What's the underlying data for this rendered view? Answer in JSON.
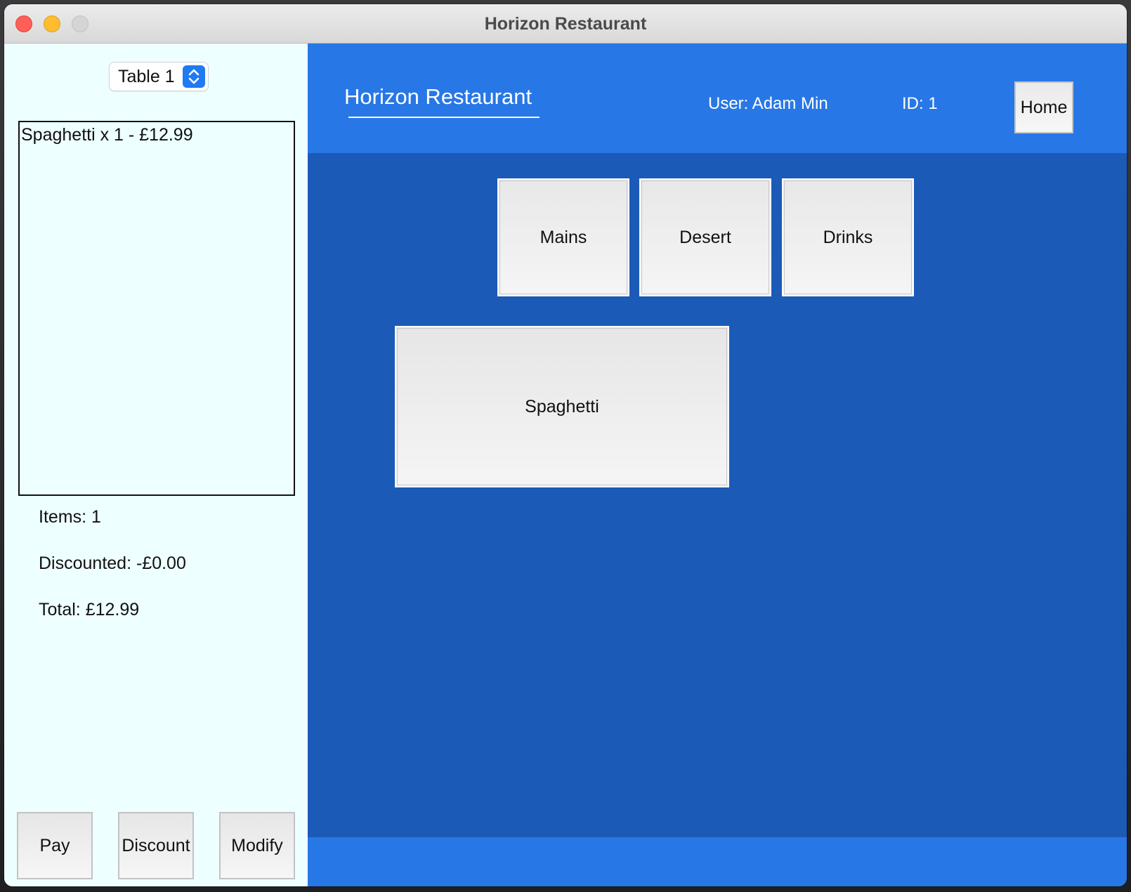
{
  "window": {
    "title": "Horizon Restaurant"
  },
  "left_panel": {
    "table_select": {
      "selected": "Table 1"
    },
    "order_items": [
      "Spaghetti x 1 - £12.99"
    ],
    "summary": {
      "items": "Items: 1",
      "discounted": "Discounted: -£0.00",
      "total": "Total: £12.99"
    },
    "buttons": {
      "pay": "Pay",
      "discount": "Discount",
      "modify": "Modify"
    }
  },
  "header": {
    "brand": "Horizon Restaurant",
    "user": "User: Adam Min",
    "id": "ID: 1",
    "home": "Home"
  },
  "categories": [
    "Mains",
    "Desert",
    "Drinks"
  ],
  "menu_items": [
    "Spaghetti"
  ],
  "colors": {
    "header_blue": "#2877e6",
    "content_blue": "#1b5ab7",
    "panel_bg": "#eeffff",
    "stepper_blue": "#1f7bf2"
  },
  "icons": {
    "select_stepper": "chevron-up-down-icon"
  }
}
